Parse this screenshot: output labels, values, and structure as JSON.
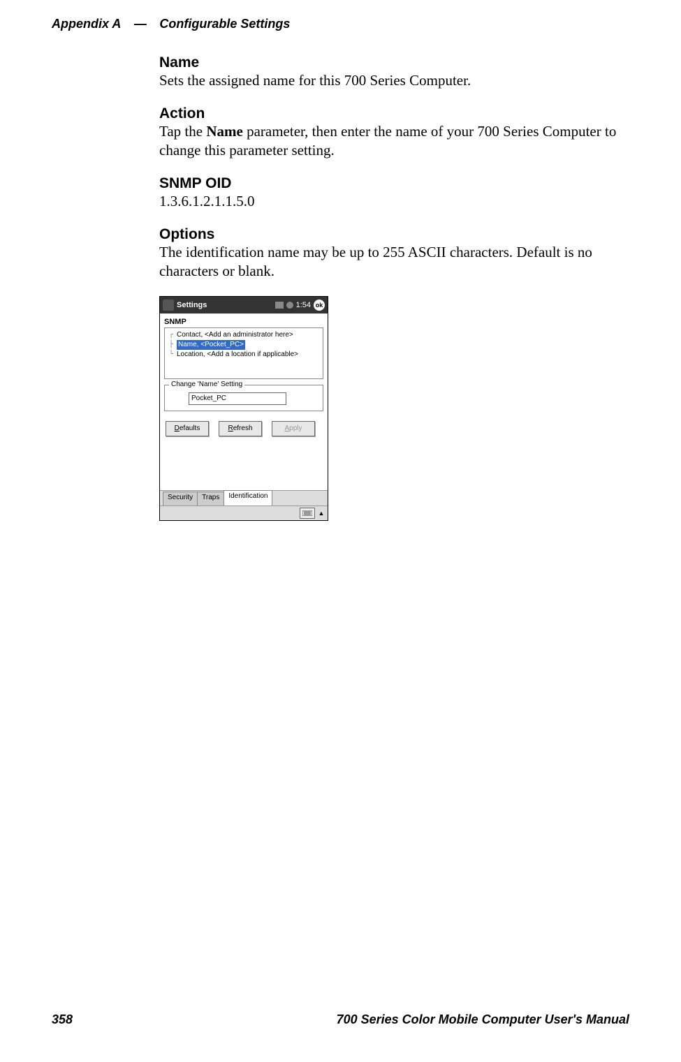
{
  "header": {
    "appendix": "Appendix A",
    "separator": "—",
    "title": "Configurable Settings"
  },
  "sections": {
    "name": {
      "heading": "Name",
      "text": "Sets the assigned name for this 700 Series Computer."
    },
    "action": {
      "heading": "Action",
      "text_pre": "Tap the ",
      "text_bold": "Name",
      "text_post": " parameter, then enter the name of your 700 Series Computer to change this parameter setting."
    },
    "snmp": {
      "heading": "SNMP OID",
      "text": "1.3.6.1.2.1.1.5.0"
    },
    "options": {
      "heading": "Options",
      "text": "The identification name may be up to 255 ASCII characters. Default is no characters or blank."
    }
  },
  "ppc": {
    "titlebar": {
      "title": "Settings",
      "time": "1:54",
      "ok": "ok"
    },
    "section_title": "SNMP",
    "tree": [
      {
        "label": "Contact, <Add an administrator here>",
        "selected": false
      },
      {
        "label": "Name, <Pocket_PC>",
        "selected": true
      },
      {
        "label": "Location, <Add a location if applicable>",
        "selected": false
      }
    ],
    "change": {
      "legend": "Change 'Name' Setting",
      "value": "Pocket_PC"
    },
    "buttons": {
      "defaults_ul": "D",
      "defaults_rest": "efaults",
      "refresh_ul": "R",
      "refresh_rest": "efresh",
      "apply_ul": "A",
      "apply_rest": "pply"
    },
    "tabs": {
      "security": "Security",
      "traps": "Traps",
      "identification": "Identification"
    }
  },
  "footer": {
    "page": "358",
    "manual": "700 Series Color Mobile Computer User's Manual"
  }
}
